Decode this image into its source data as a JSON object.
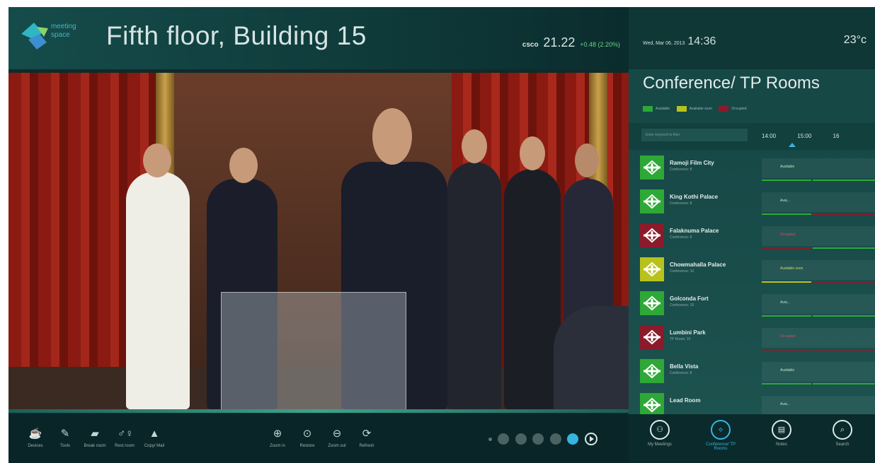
{
  "header": {
    "logo_text_1": "meeting",
    "logo_text_2": "space",
    "title": "Fifth floor, Building 15",
    "stock": {
      "symbol": "csco",
      "value": "21.22",
      "change": "+0.48 (2.20%)"
    }
  },
  "toolbar": {
    "tools": [
      {
        "label": "Devices",
        "icon": "coffee-icon"
      },
      {
        "label": "Tools",
        "icon": "pen-icon"
      },
      {
        "label": "Break room",
        "icon": "cup-icon"
      },
      {
        "label": "Rest room",
        "icon": "restroom-icon"
      },
      {
        "label": "Copy/ Mail",
        "icon": "printer-icon"
      },
      {
        "label": "Zoom in",
        "icon": "zoom-in-icon"
      },
      {
        "label": "Restore",
        "icon": "zoom-restore-icon"
      },
      {
        "label": "Zoom out",
        "icon": "zoom-out-icon"
      },
      {
        "label": "Refresh",
        "icon": "refresh-icon"
      }
    ],
    "pager_active_index": 4
  },
  "panel": {
    "date": "Wed, Mar 06, 2013",
    "time": "14:36",
    "temperature": "23°c",
    "title": "Conference/ TP Rooms",
    "legend": [
      {
        "label": "Available",
        "color": "#2ea836"
      },
      {
        "label": "Available soon",
        "color": "#b8c21c"
      },
      {
        "label": "Occupied",
        "color": "#8b1b2a"
      }
    ],
    "search_placeholder": "Enter keyword to filter",
    "times": [
      "14:00",
      "15:00",
      "16"
    ],
    "rooms": [
      {
        "name": "Ramoji Film City",
        "sub": "Conference: 8",
        "status": "Available",
        "state": "available"
      },
      {
        "name": "King Kothi Palace",
        "sub": "Conference: 8",
        "status": "Avai...",
        "state": "available"
      },
      {
        "name": "Falaknuma Palace",
        "sub": "Conference: 6",
        "status": "Occupied",
        "state": "occupied"
      },
      {
        "name": "Chowmahalla Palace",
        "sub": "Conference: 10",
        "status": "Available soon",
        "state": "soon"
      },
      {
        "name": "Golconda Fort",
        "sub": "Conference: 10",
        "status": "Avai...",
        "state": "available"
      },
      {
        "name": "Lumbini Park",
        "sub": "TP Room: 10",
        "status": "Occupied",
        "state": "occupied"
      },
      {
        "name": "Bella Vista",
        "sub": "Conference: 8",
        "status": "Available",
        "state": "available"
      },
      {
        "name": "Lead Room",
        "sub": "",
        "status": "Avai...",
        "state": "available"
      }
    ]
  },
  "nav": {
    "items": [
      {
        "label": "My Meetings",
        "icon": "people-icon"
      },
      {
        "label": "Conference/ TP Rooms",
        "icon": "room-icon"
      },
      {
        "label": "Notes",
        "icon": "notes-icon"
      },
      {
        "label": "Search",
        "icon": "search-icon"
      }
    ]
  },
  "colors": {
    "accent": "#35b5e0",
    "available": "#2ea836",
    "soon": "#b8c21c",
    "occupied": "#8b1b2a"
  }
}
